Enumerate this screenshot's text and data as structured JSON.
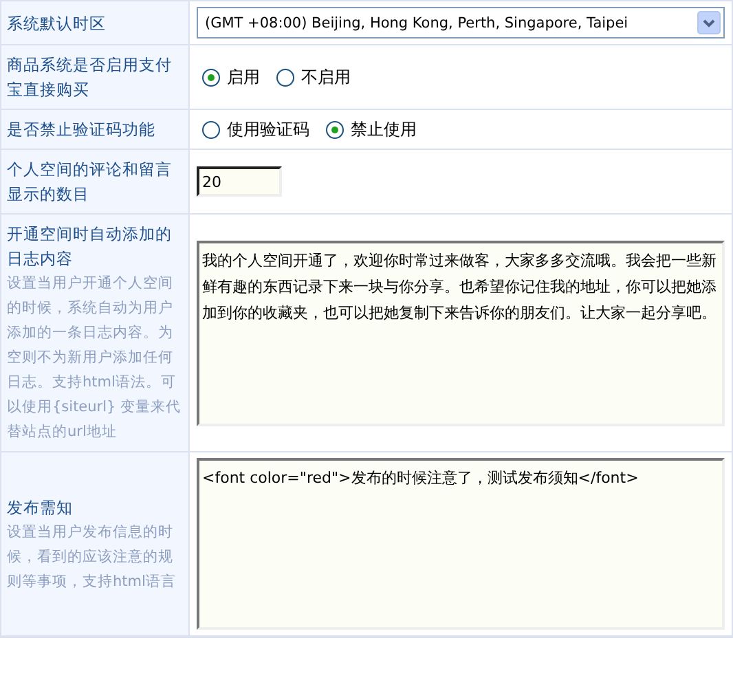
{
  "settings": [
    {
      "kind": "select",
      "label": "系统默认时区",
      "value": "(GMT +08:00) Beijing, Hong Kong, Perth, Singapore, Taipei"
    },
    {
      "kind": "radio",
      "label": "商品系统是否启用支付宝直接购买",
      "options": [
        {
          "label": "启用",
          "selected": true
        },
        {
          "label": "不启用",
          "selected": false
        }
      ]
    },
    {
      "kind": "radio",
      "label": "是否禁止验证码功能",
      "options": [
        {
          "label": "使用验证码",
          "selected": false
        },
        {
          "label": "禁止使用",
          "selected": true
        }
      ]
    },
    {
      "kind": "text",
      "label": "个人空间的评论和留言显示的数目",
      "value": "20"
    },
    {
      "kind": "textarea",
      "label": "开通空间时自动添加的日志内容",
      "description": "设置当用户开通个人空间的时候，系统自动为用户添加的一条日志内容。为空则不为新用户添加任何日志。支持html语法。可以使用{siteurl} 变量来代替站点的url地址",
      "value": "我的个人空间开通了，欢迎你时常过来做客，大家多多交流哦。我会把一些新鲜有趣的东西记录下来一块与你分享。也希望你记住我的地址，你可以把她添加到你的收藏夹，也可以把她复制下来告诉你的朋友们。让大家一起分享吧。"
    },
    {
      "kind": "textarea",
      "label": "发布需知",
      "description": "设置当用户发布信息的时候，看到的应该注意的规则等事项，支持html语言",
      "value": "<font color=\"red\">发布的时候注意了，测试发布须知</font>"
    }
  ]
}
